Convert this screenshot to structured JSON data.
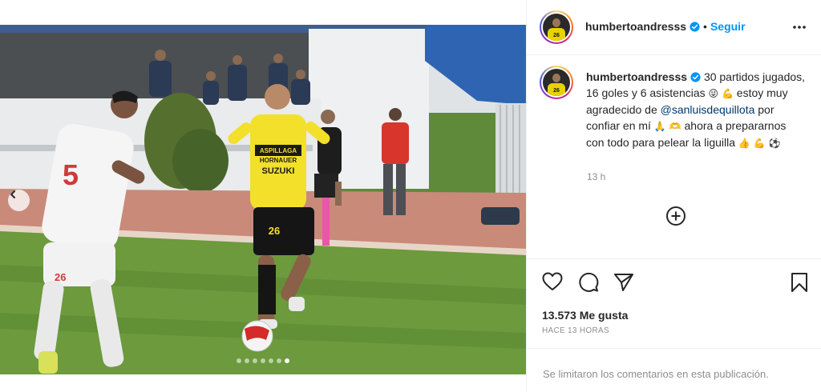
{
  "post": {
    "username": "humbertoandresss",
    "follow_label": "Seguir",
    "separator": "•",
    "caption_parts": {
      "line1": "30 partidos jugados, 16 goles y 6 asistencias",
      "line2": "estoy muy agradecido de",
      "mention": "@sanluisdequillota",
      "line3": "por confiar en mí",
      "line4": "ahora a prepararnos con todo para pelear la liguilla"
    },
    "timestamp": "13 h",
    "likes_text": "13.573 Me gusta",
    "posted_ago": "HACE 13 HORAS",
    "comments_disabled_text": "Se limitaron los comentarios en esta publicación."
  },
  "photo": {
    "jersey_number": "26",
    "sponsor_1": "ASPILLAGA",
    "sponsor_2": "HORNAUER",
    "sponsor_3": "SUZUKI",
    "carousel_dots": 7,
    "active_dot": 6
  },
  "icons": {
    "verified": "verified-badge-icon",
    "more": "more-options-icon",
    "load_more": "plus-circle-icon",
    "like": "heart-icon",
    "comment": "comment-icon",
    "share": "share-icon",
    "save": "bookmark-icon",
    "prev": "chevron-left-icon"
  },
  "colors": {
    "accent": "#0095f6",
    "mention": "#00376b",
    "muted": "#8e8e8e",
    "text": "#262626"
  }
}
